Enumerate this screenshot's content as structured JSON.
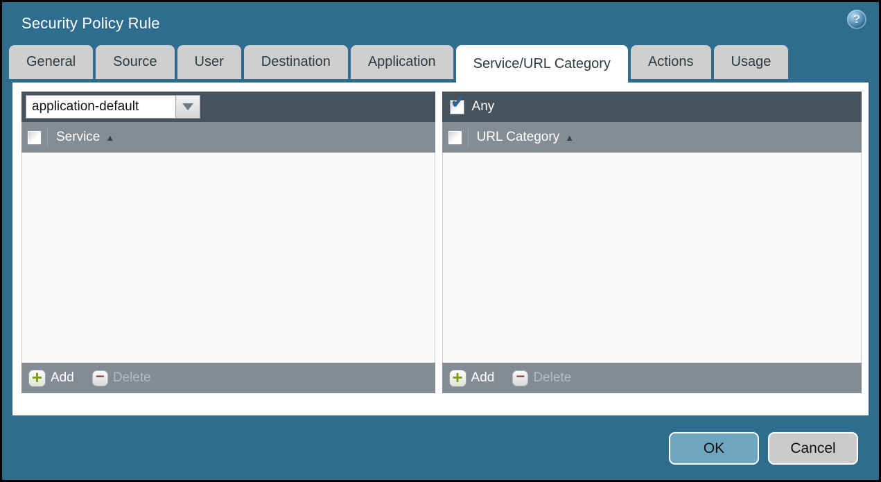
{
  "window": {
    "title": "Security Policy Rule",
    "help_glyph": "?"
  },
  "tabs": [
    {
      "label": "General"
    },
    {
      "label": "Source"
    },
    {
      "label": "User"
    },
    {
      "label": "Destination"
    },
    {
      "label": "Application"
    },
    {
      "label": "Service/URL Category",
      "active": true
    },
    {
      "label": "Actions"
    },
    {
      "label": "Usage"
    }
  ],
  "service_panel": {
    "mode_value": "application-default",
    "column_header": "Service",
    "sort_icon": "▲",
    "add_label": "Add",
    "delete_label": "Delete",
    "delete_enabled": false,
    "rows": []
  },
  "url_panel": {
    "any_label": "Any",
    "any_checked": true,
    "any_check_glyph": "✔",
    "column_header": "URL Category",
    "sort_icon": "▲",
    "add_label": "Add",
    "delete_label": "Delete",
    "delete_enabled": false,
    "rows": []
  },
  "dialog_actions": {
    "ok_label": "OK",
    "cancel_label": "Cancel"
  },
  "icons": {
    "add_glyph": "+",
    "delete_glyph": "−",
    "dropdown": "caret-down"
  },
  "colors": {
    "dialog_background": "#2e6d8d",
    "toolbar_dark": "#46525c",
    "header_gray": "#858d94",
    "footer_gray": "#838b94",
    "ok_button": "#6fa6bf",
    "cancel_button": "#cbcbcb",
    "add_plus": "#7e9c14",
    "delete_minus": "#8a4a3c",
    "check_blue": "#2a6496"
  }
}
